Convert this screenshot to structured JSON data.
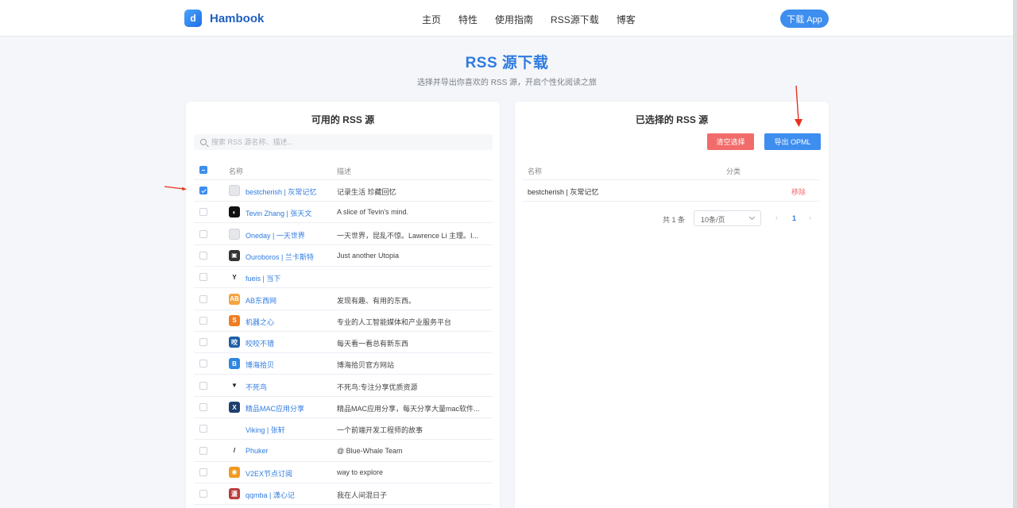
{
  "header": {
    "logo_text": "Hambook",
    "logo_glyph": "d",
    "nav": [
      "主页",
      "特性",
      "使用指南",
      "RSS源下载",
      "博客"
    ],
    "download_label": "下载 App"
  },
  "page": {
    "title": "RSS 源下载",
    "subtitle": "选择并导出你喜欢的 RSS 源，开启个性化阅读之旅"
  },
  "available": {
    "title": "可用的 RSS 源",
    "search_placeholder": "搜索 RSS 源名称、描述...",
    "col_name": "名称",
    "col_desc": "描述",
    "rows": [
      {
        "name": "bestcherish | 灰常记忆",
        "desc": "记录生活 珍藏回忆",
        "checked": true,
        "icon": "broken-image",
        "color": "#e5e7eb",
        "glyph": ""
      },
      {
        "name": "Tevin Zhang | 张天文",
        "desc": "A slice of Tevin's mind.",
        "checked": false,
        "icon": "tevin-icon",
        "color": "#111111",
        "glyph": "◐"
      },
      {
        "name": "Oneday | 一天世界",
        "desc": "一天世界，昆乱不惊。Lawrence Li 主理。I...",
        "checked": false,
        "icon": "broken-image",
        "color": "#e5e7eb",
        "glyph": ""
      },
      {
        "name": "Ouroboros | 兰卡斯特",
        "desc": "Just another Utopia",
        "checked": false,
        "icon": "ouroboros-icon",
        "color": "#333333",
        "glyph": "▣"
      },
      {
        "name": "fueis | 当下",
        "desc": "",
        "checked": false,
        "icon": "sprout-icon",
        "color": "#ffffff",
        "glyph": "Y"
      },
      {
        "name": "AB东西网",
        "desc": "发现有趣、有用的东西。",
        "checked": false,
        "icon": "ab-icon",
        "color": "#f4a340",
        "glyph": "AB"
      },
      {
        "name": "机器之心",
        "desc": "专业的人工智能媒体和产业服务平台",
        "checked": false,
        "icon": "jiqizhixin-icon",
        "color": "#f07d22",
        "glyph": "S"
      },
      {
        "name": "咬咬不错",
        "desc": "每天看一看总有新东西",
        "checked": false,
        "icon": "yao-icon",
        "color": "#1e5fa8",
        "glyph": "咬"
      },
      {
        "name": "博海拾贝",
        "desc": "博海拾贝官方网站",
        "checked": false,
        "icon": "bohai-icon",
        "color": "#2f86e0",
        "glyph": "B"
      },
      {
        "name": "不死鸟",
        "desc": "不死鸟:专注分享优质资源",
        "checked": false,
        "icon": "phoenix-icon",
        "color": "#ffffff",
        "glyph": "▼"
      },
      {
        "name": "精品MAC应用分享",
        "desc": "精品MAC应用分享，每天分享大量mac软件...",
        "checked": false,
        "icon": "mac-share-icon",
        "color": "#1f3f6e",
        "glyph": "X"
      },
      {
        "name": "Viking | 张轩",
        "desc": "一个前端开发工程师的故事",
        "checked": false,
        "icon": "blank-icon",
        "color": "#ffffff",
        "glyph": ""
      },
      {
        "name": "Phuker",
        "desc": "@ Blue-Whale Team",
        "checked": false,
        "icon": "knife-icon",
        "color": "#ffffff",
        "glyph": "/"
      },
      {
        "name": "V2EX节点订阅",
        "desc": "way to explore",
        "checked": false,
        "icon": "rss-icon",
        "color": "#f09a20",
        "glyph": "◉"
      },
      {
        "name": "qqmba | 潇心记",
        "desc": "我在人间混日子",
        "checked": false,
        "icon": "qqmba-icon",
        "color": "#b83c3c",
        "glyph": "潇"
      }
    ]
  },
  "selected": {
    "title": "已选择的 RSS 源",
    "clear_label": "清空选择",
    "export_label": "导出 OPML",
    "col_name": "名称",
    "col_category": "分类",
    "rows": [
      {
        "name": "bestcherish | 灰常记忆",
        "category": "",
        "remove_label": "移除"
      }
    ],
    "pager": {
      "total": "共 1 条",
      "page_size": "10条/页",
      "prev": "‹",
      "current": "1",
      "next": "›"
    }
  },
  "colors": {
    "accent": "#3d8eef",
    "title_blue": "#2f7be0",
    "danger": "#f16b6b",
    "annotation_arrow": "#e8321e"
  }
}
